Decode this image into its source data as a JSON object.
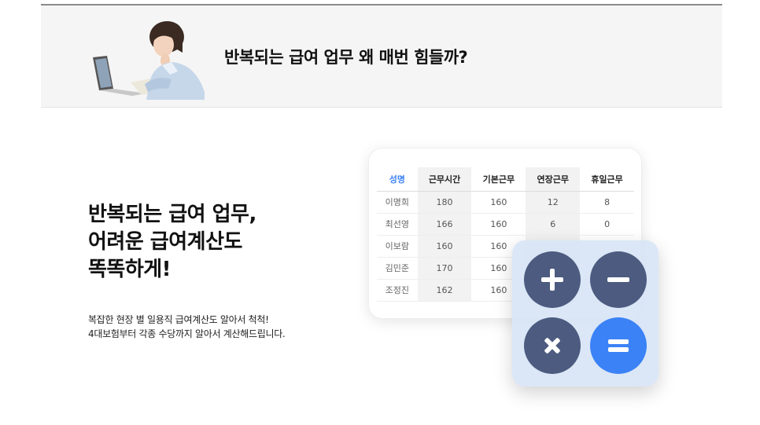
{
  "banner": {
    "title": "반복되는 급여 업무 왜 매번 힘들까?",
    "illustration_icon": "woman-with-laptop-illustration"
  },
  "hero": {
    "heading_lines": [
      "반복되는 급여 업무,",
      "어려운 급여계산도",
      "똑똑하게!"
    ],
    "desc_lines": [
      "복잡한 현장 별 일용직 급여계산도 알아서 척척!",
      "4대보험부터 각종 수당까지 알아서 계산해드립니다."
    ]
  },
  "table": {
    "headers": [
      "성명",
      "근무시간",
      "기본근무",
      "연장근무",
      "휴일근무"
    ],
    "rows": [
      [
        "이명희",
        "180",
        "160",
        "12",
        "8"
      ],
      [
        "최선영",
        "166",
        "160",
        "6",
        "0"
      ],
      [
        "이보람",
        "160",
        "160",
        "",
        ""
      ],
      [
        "김민준",
        "170",
        "160",
        "",
        ""
      ],
      [
        "조정진",
        "162",
        "160",
        "",
        ""
      ]
    ],
    "header_accent_color": "#3b82f6"
  },
  "calculator": {
    "buttons": [
      {
        "name": "plus-icon",
        "color": "#4c5b7f"
      },
      {
        "name": "minus-icon",
        "color": "#4c5b7f"
      },
      {
        "name": "times-icon",
        "color": "#4c5b7f"
      },
      {
        "name": "equals-icon",
        "color": "#3b82f6"
      }
    ]
  }
}
